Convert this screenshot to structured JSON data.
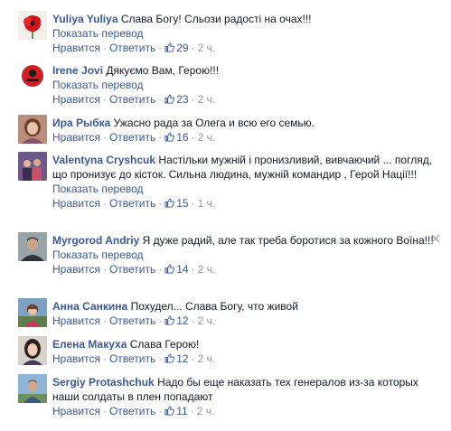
{
  "labels": {
    "translate": "Показать перевод",
    "like": "Нравится",
    "reply": "Ответить",
    "dot": "·"
  },
  "colors": {
    "link": "#3b5998",
    "meta": "#9197a3",
    "text": "#141823"
  },
  "comments": [
    {
      "author": "Yuliya Yuliya",
      "text": "Слава Богу! Сльози радості на очах!!!",
      "likes": "29",
      "time": "2 ч.",
      "avatar_icon": "red-poppy-avatar-icon"
    },
    {
      "author": "Irene Jovi",
      "text": "Дякуємо Вам, Герою!!!",
      "likes": "23",
      "time": "2 ч.",
      "avatar_icon": "red-circle-logo-avatar-icon"
    },
    {
      "author": "Ира Рыбка",
      "text": "Ужасно рада за Олега и всю его семью.",
      "likes": "16",
      "time": "2 ч.",
      "avatar_icon": "woman-portrait-avatar-icon"
    },
    {
      "author": "Valentyna Cryshcuk",
      "text": "Настільки мужній і пронизливий, вивчаючий ... погляд, що пронизує до кісток. Сильна людина, мужній командир , Герой Нації!!!",
      "likes": "15",
      "time": "1 ч.",
      "avatar_icon": "group-photo-avatar-icon"
    },
    {
      "author": "Myrgorod Andriy",
      "text": "Я дуже радий, але так треба боротися за кожного Воїна!!!",
      "likes": "14",
      "time": "2 ч.",
      "avatar_icon": "man-portrait-avatar-icon"
    },
    {
      "author": "Анна Санкина",
      "text": "Похудел... Слава Богу, что живой",
      "likes": "12",
      "time": "2 ч.",
      "avatar_icon": "woman-outdoor-avatar-icon"
    },
    {
      "author": "Елена Макуха",
      "text": "Слава Герою!",
      "likes": "12",
      "time": "2 ч.",
      "avatar_icon": "woman-dark-hair-avatar-icon"
    },
    {
      "author": "Sergiy Protashchuk",
      "text": "Надо бы еще наказать тех генералов из-за которых наши солдаты в плен попадают",
      "likes": "11",
      "time": "2 ч.",
      "avatar_icon": "man-outdoor-avatar-icon"
    }
  ]
}
